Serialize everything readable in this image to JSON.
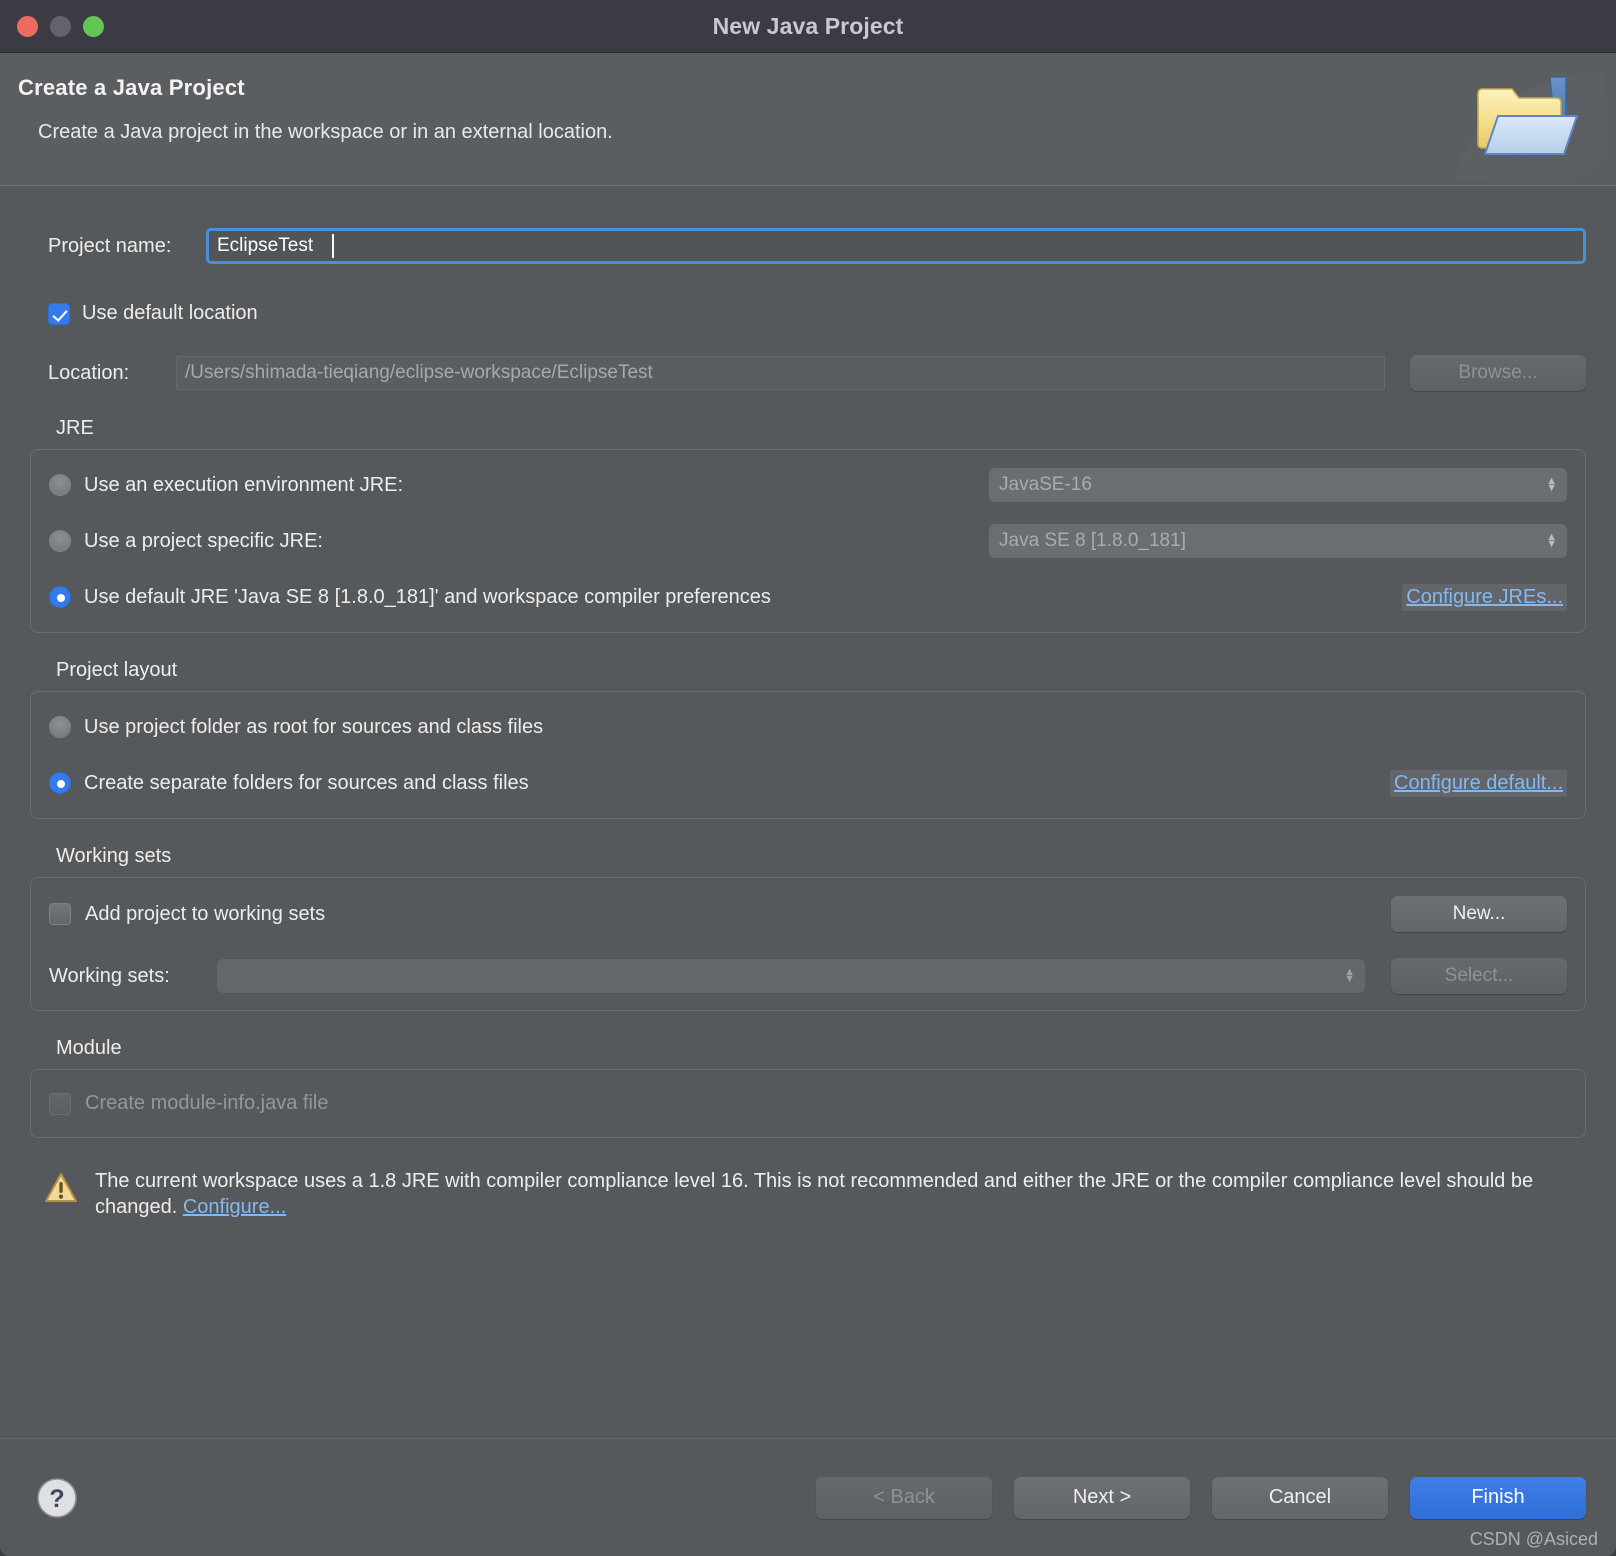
{
  "window": {
    "title": "New Java Project",
    "traffic_lights": [
      "close",
      "minimize",
      "maximize"
    ]
  },
  "header": {
    "title": "Create a Java Project",
    "subtitle": "Create a Java project in the workspace or in an external location.",
    "icon": "java-project-folder-icon"
  },
  "form": {
    "project_name_label": "Project name:",
    "project_name_value": "EclipseTest",
    "use_default_location_label": "Use default location",
    "use_default_location_checked": true,
    "location_label": "Location:",
    "location_value": "/Users/shimada-tieqiang/eclipse-workspace/EclipseTest",
    "browse_label": "Browse..."
  },
  "jre": {
    "group_title": "JRE",
    "options": [
      {
        "label": "Use an execution environment JRE:",
        "selected": false,
        "combo_value": "JavaSE-16"
      },
      {
        "label": "Use a project specific JRE:",
        "selected": false,
        "combo_value": "Java SE 8 [1.8.0_181]"
      },
      {
        "label": "Use default JRE 'Java SE 8 [1.8.0_181]' and workspace compiler preferences",
        "selected": true
      }
    ],
    "configure_link": "Configure JREs..."
  },
  "project_layout": {
    "group_title": "Project layout",
    "options": [
      {
        "label": "Use project folder as root for sources and class files",
        "selected": false
      },
      {
        "label": "Create separate folders for sources and class files",
        "selected": true
      }
    ],
    "configure_link": "Configure default..."
  },
  "working_sets": {
    "group_title": "Working sets",
    "add_label": "Add project to working sets",
    "add_checked": false,
    "new_button": "New...",
    "sets_label": "Working sets:",
    "sets_value": "",
    "select_button": "Select..."
  },
  "module": {
    "group_title": "Module",
    "create_label": "Create module-info.java file",
    "create_checked": false
  },
  "warning": {
    "icon": "warning-triangle-icon",
    "text": "The current workspace uses a 1.8 JRE with compiler compliance level 16. This is not recommended and either the JRE or the compiler compliance level should be changed. ",
    "link": "Configure..."
  },
  "footer": {
    "help": "?",
    "back": "< Back",
    "next": "Next >",
    "cancel": "Cancel",
    "finish": "Finish",
    "watermark": "CSDN @Asiced"
  },
  "colors": {
    "accent": "#357aea",
    "link": "#84b8ef",
    "window_bg": "#56595c",
    "titlebar_bg": "#3b3b43",
    "finish_btn": "#3576e0"
  }
}
